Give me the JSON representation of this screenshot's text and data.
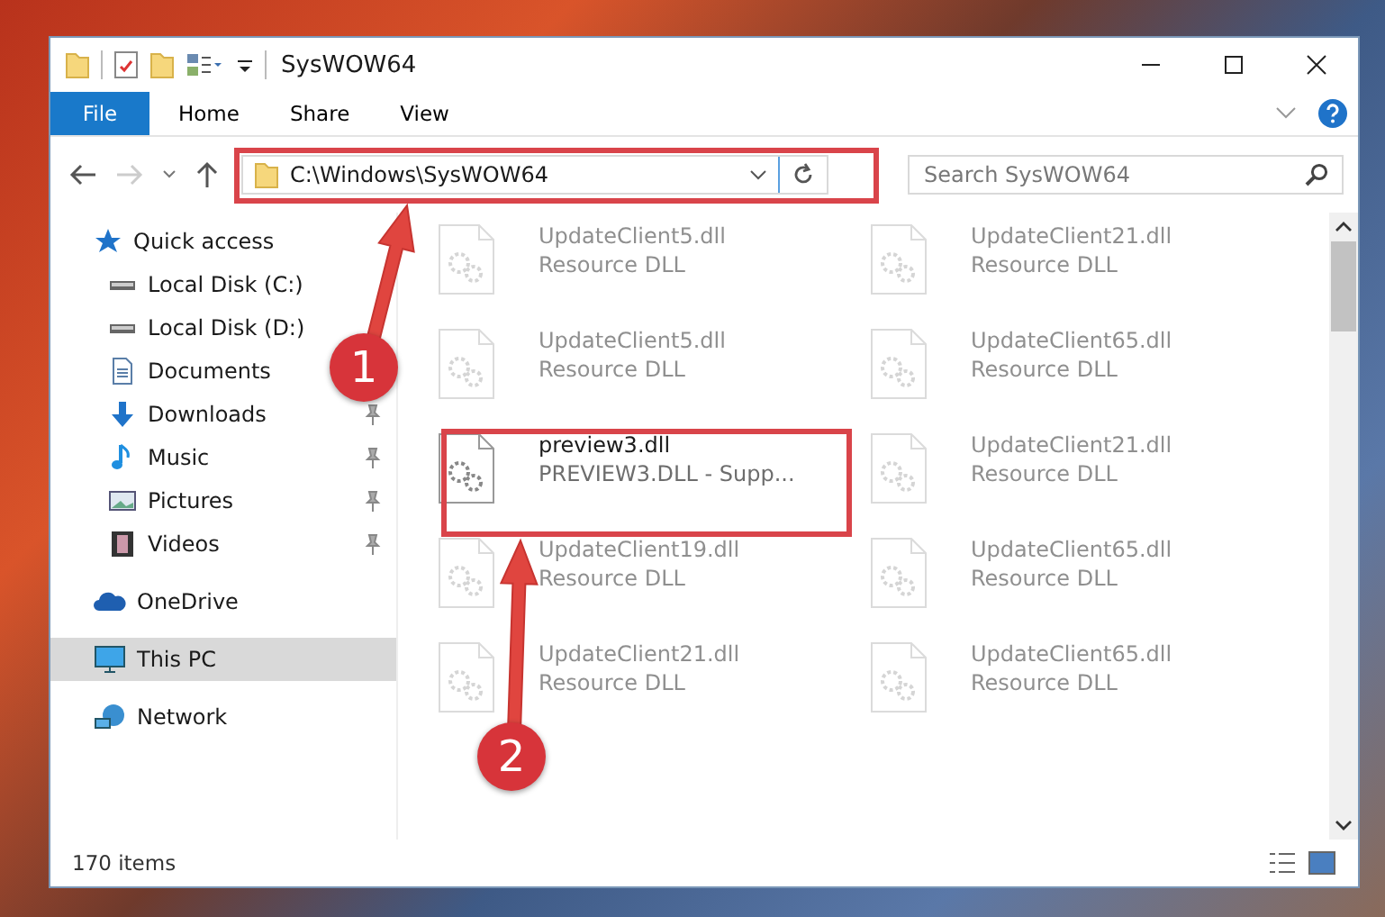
{
  "window": {
    "title": "SysWOW64"
  },
  "file_tab": "File",
  "ribbon_tabs": [
    "Home",
    "Share",
    "View"
  ],
  "address": {
    "path": "C:\\Windows\\SysWOW64"
  },
  "search": {
    "placeholder": "Search SysWOW64"
  },
  "sidebar": {
    "items": [
      {
        "label": "Quick access",
        "kind": "star",
        "selected": false,
        "children": [
          {
            "label": "Local Disk (C:)",
            "kind": "drive",
            "pinned": false
          },
          {
            "label": "Local Disk (D:)",
            "kind": "drive",
            "pinned": false
          },
          {
            "label": "Documents",
            "kind": "document",
            "pinned": false
          },
          {
            "label": "Downloads",
            "kind": "download",
            "pinned": true
          },
          {
            "label": "Music",
            "kind": "music",
            "pinned": true
          },
          {
            "label": "Pictures",
            "kind": "picture",
            "pinned": true
          },
          {
            "label": "Videos",
            "kind": "video",
            "pinned": true
          }
        ]
      },
      {
        "label": "OneDrive",
        "kind": "cloud",
        "selected": false
      },
      {
        "label": "This PC",
        "kind": "computer",
        "selected": true
      },
      {
        "label": "Network",
        "kind": "network",
        "selected": false
      }
    ]
  },
  "files": [
    {
      "name": "UpdateClient5.dll",
      "type": "Resource DLL",
      "dimmed": true
    },
    {
      "name": "UpdateClient21.dll",
      "type": "Resource DLL",
      "dimmed": true
    },
    {
      "name": "UpdateClient5.dll",
      "type": "Resource DLL",
      "dimmed": true
    },
    {
      "name": "UpdateClient65.dll",
      "type": "Resource DLL",
      "dimmed": true
    },
    {
      "name": "preview3.dll",
      "type": "PREVIEW3.DLL - Supp...",
      "dimmed": false
    },
    {
      "name": "UpdateClient21.dll",
      "type": "Resource DLL",
      "dimmed": true
    },
    {
      "name": "UpdateClient19.dll",
      "type": "Resource DLL",
      "dimmed": true
    },
    {
      "name": "UpdateClient65.dll",
      "type": "Resource DLL",
      "dimmed": true
    },
    {
      "name": "UpdateClient21.dll",
      "type": "Resource DLL",
      "dimmed": true
    },
    {
      "name": "UpdateClient65.dll",
      "type": "Resource DLL",
      "dimmed": true
    }
  ],
  "status_bar": {
    "item_count": "170 items"
  },
  "annotations": [
    {
      "number": "1"
    },
    {
      "number": "2"
    }
  ]
}
